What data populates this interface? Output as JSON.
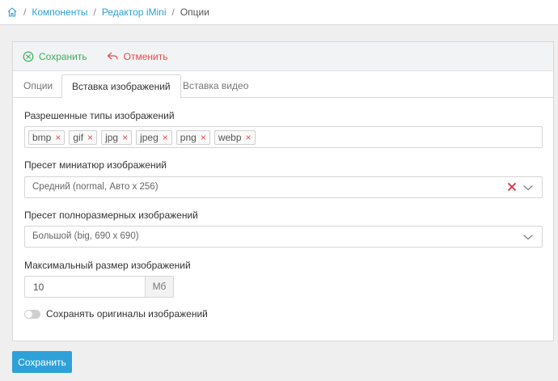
{
  "breadcrumb": {
    "items": [
      "Компоненты",
      "Редактор iMini"
    ],
    "current": "Опции",
    "separator": "/"
  },
  "toolbar": {
    "save_label": "Сохранить",
    "cancel_label": "Отменить"
  },
  "tabs": [
    {
      "label": "Опции",
      "active": false
    },
    {
      "label": "Вставка изображений",
      "active": true
    },
    {
      "label": "Вставка видео",
      "active": false
    }
  ],
  "form": {
    "allowed_types": {
      "label": "Разрешенные типы изображений",
      "tags": [
        "bmp",
        "gif",
        "jpg",
        "jpeg",
        "png",
        "webp"
      ],
      "remove_glyph": "×"
    },
    "thumb_preset": {
      "label": "Пресет миниатюр изображений",
      "value": "Средний (normal, Авто x 256)"
    },
    "full_preset": {
      "label": "Пресет полноразмерных изображений",
      "value": "Большой (big, 690 x 690)"
    },
    "max_size": {
      "label": "Максимальный размер изображений",
      "value": "10",
      "unit": "Мб"
    },
    "keep_originals": {
      "label": "Сохранять оригиналы изображений",
      "enabled": false
    }
  },
  "footer": {
    "save_label": "Сохранить"
  },
  "colors": {
    "accent": "#2ea1d8",
    "save_green": "#3cae5c",
    "cancel_red": "#e8494a"
  },
  "icons": {
    "home": "home-icon",
    "save": "save-circle-icon",
    "cancel": "undo-arrow-icon",
    "clear": "close-icon",
    "dropdown": "chevron-down-icon"
  }
}
